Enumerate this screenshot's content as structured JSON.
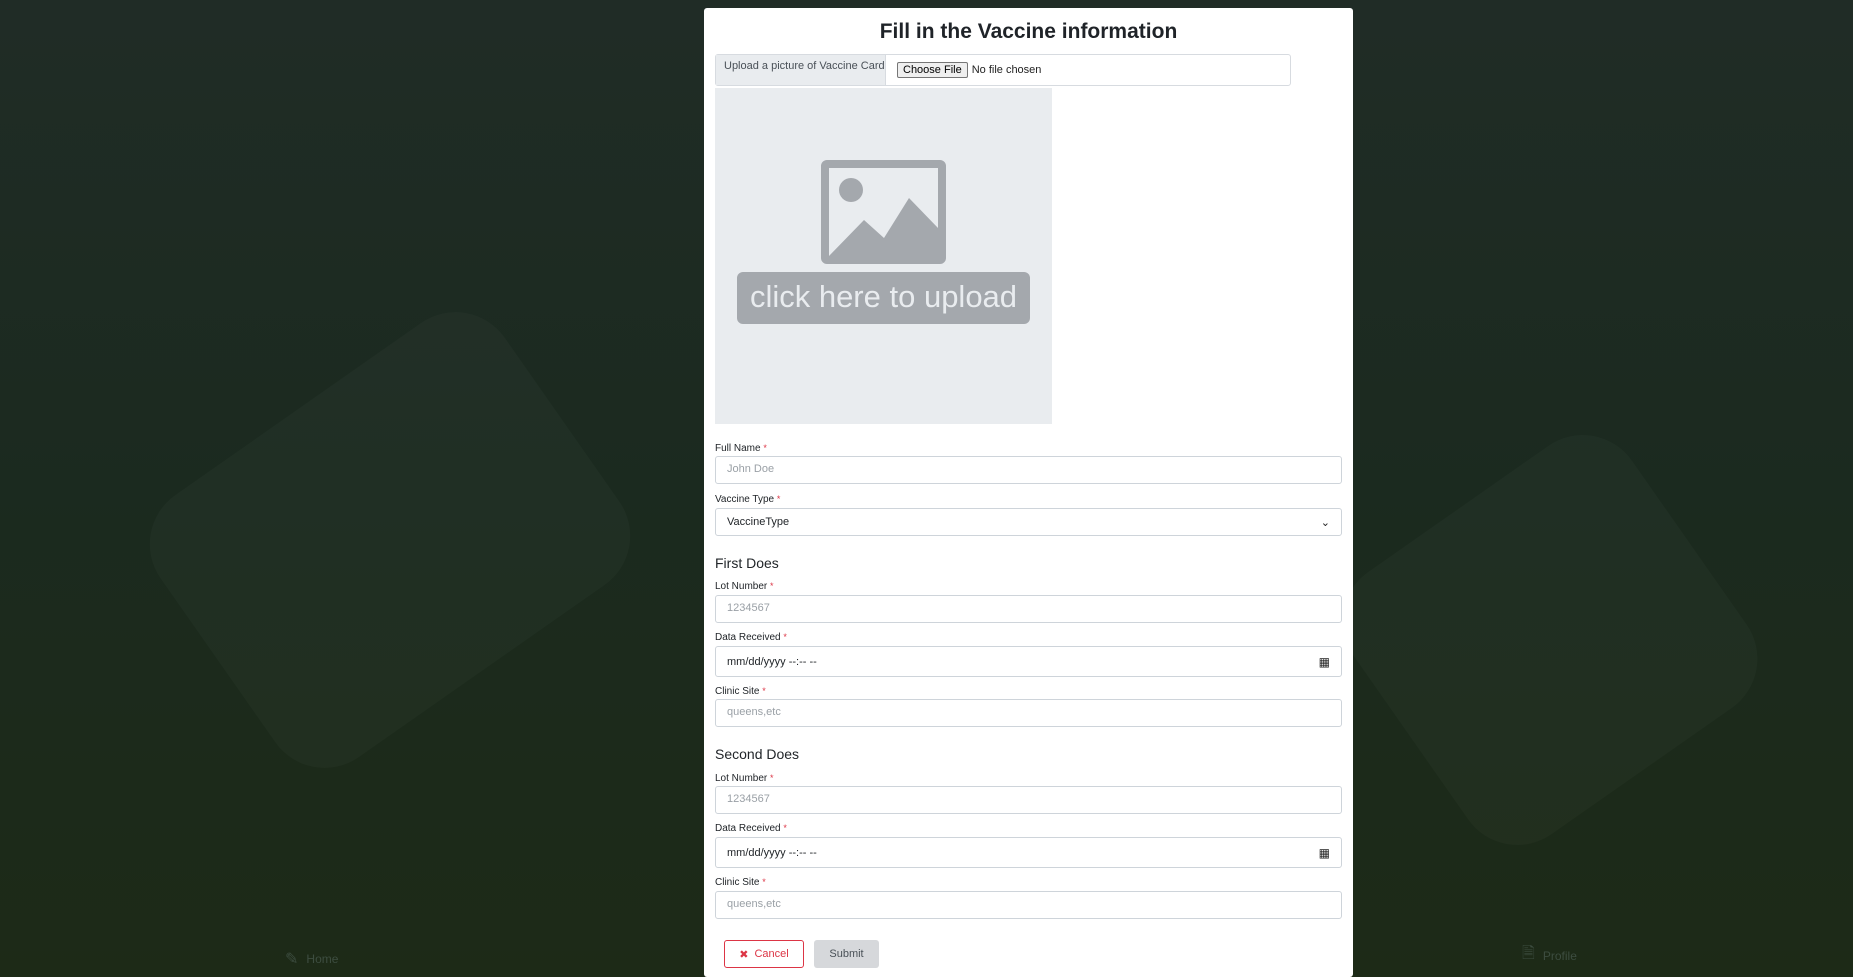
{
  "modal": {
    "title": "Fill in the Vaccine information",
    "upload": {
      "label": "Upload a picture of Vaccine Card",
      "choose_button": "Choose File",
      "file_status": "No file chosen",
      "placeholder_text": "click here to upload"
    },
    "full_name": {
      "label": "Full Name",
      "placeholder": "John Doe"
    },
    "vaccine_type": {
      "label": "Vaccine Type",
      "selected": "VaccineType"
    },
    "first_dose": {
      "heading": "First Does",
      "lot_label": "Lot Number",
      "lot_placeholder": "1234567",
      "date_label": "Data Received",
      "date_placeholder": "mm/dd/yyyy --:-- --",
      "clinic_label": "Clinic Site",
      "clinic_placeholder": "queens,etc"
    },
    "second_dose": {
      "heading": "Second Does",
      "lot_label": "Lot Number",
      "lot_placeholder": "1234567",
      "date_label": "Data Received",
      "date_placeholder": "mm/dd/yyyy --:-- --",
      "clinic_label": "Clinic Site",
      "clinic_placeholder": "queens,etc"
    },
    "required_marker": "*",
    "buttons": {
      "cancel": "Cancel",
      "submit": "Submit"
    }
  },
  "bottom_nav": {
    "home": "Home",
    "profile": "Profile"
  },
  "icons": {
    "image": "image-placeholder-icon",
    "calendar": "calendar-icon",
    "chevron": "chevron-down-icon",
    "cancel": "close-icon",
    "home": "pencil-icon",
    "profile": "document-icon"
  },
  "colors": {
    "accent_danger": "#dc3545",
    "upload_bg": "#e9ecef",
    "page_bg": "#1f2b23"
  }
}
